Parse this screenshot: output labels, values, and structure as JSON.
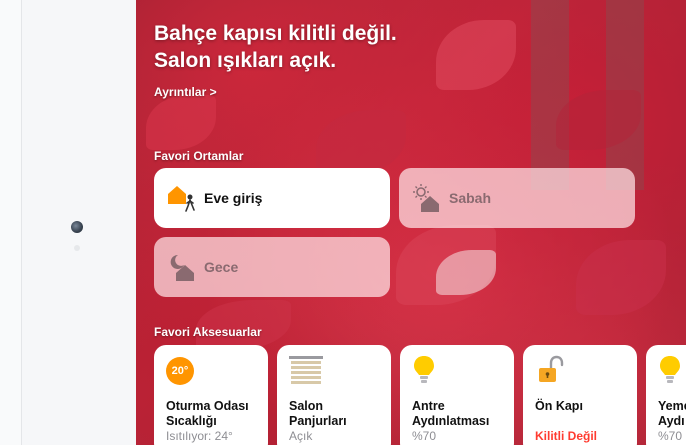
{
  "headline": {
    "line1": "Bahçe kapısı kilitli değil.",
    "line2": "Salon ışıkları açık."
  },
  "details_link": "Ayrıntılar >",
  "favorite_scenes": {
    "title": "Favori Ortamlar",
    "items": [
      {
        "label": "Eve giriş",
        "icon": "house-person-icon",
        "active": true
      },
      {
        "label": "Sabah",
        "icon": "house-sunrise-icon",
        "active": false
      },
      {
        "label": "Gece",
        "icon": "house-moon-icon",
        "active": false
      }
    ]
  },
  "favorite_accessories": {
    "title": "Favori Aksesuarlar",
    "items": [
      {
        "name_line1": "Oturma Odası",
        "name_line2": "Sıcaklığı",
        "status": "Isıtılıyor: 24°",
        "icon": "thermostat-icon",
        "badge": "20°"
      },
      {
        "name_line1": "Salon",
        "name_line2": "Panjurları",
        "status": "Açık",
        "icon": "blinds-icon"
      },
      {
        "name_line1": "Antre",
        "name_line2": "Aydınlatması",
        "status": "%70",
        "icon": "lightbulb-icon"
      },
      {
        "name_line1": "Ön Kapı",
        "name_line2": "",
        "status": "Kilitli Değil",
        "icon": "unlocked-lock-icon"
      },
      {
        "name_line1": "Yeme",
        "name_line2": "Aydı",
        "status": "%70",
        "icon": "lightbulb-icon"
      }
    ]
  },
  "colors": {
    "accent_orange": "#ff9500",
    "light_yellow": "#ffcc00",
    "alert_red": "#ff3b30",
    "lock_gold": "#f5a623"
  }
}
